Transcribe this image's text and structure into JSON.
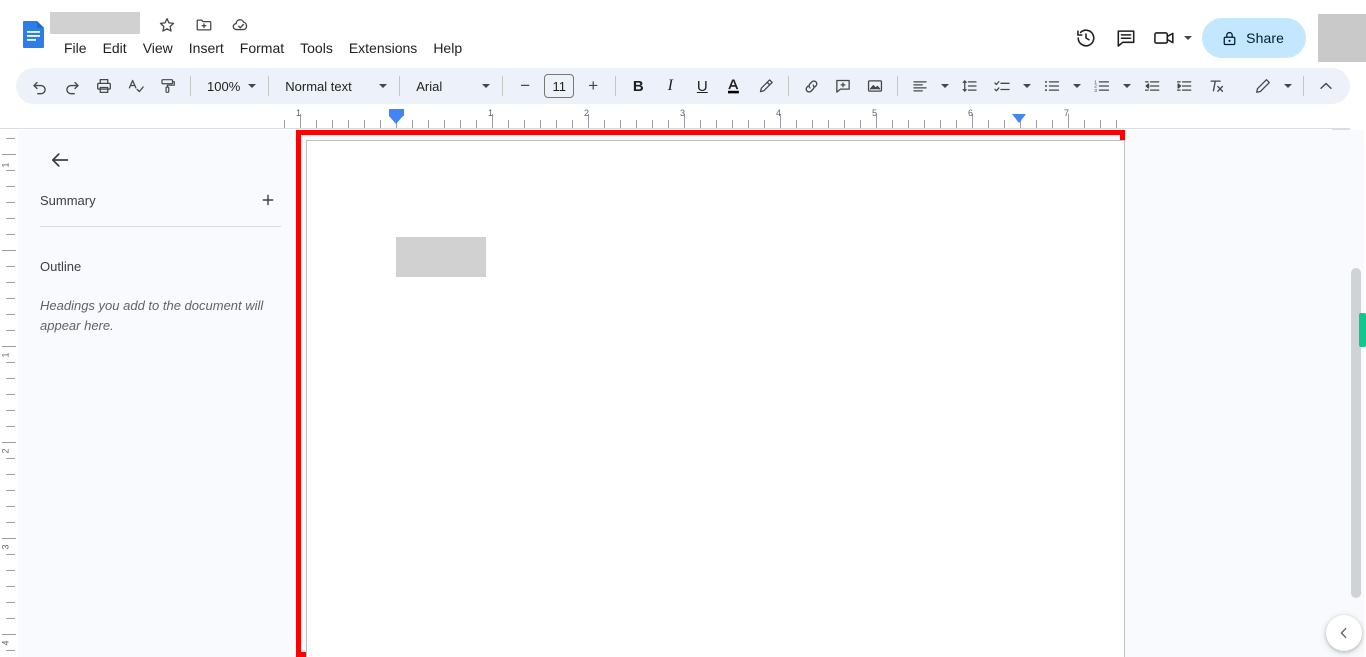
{
  "app": {
    "name": "Google Docs",
    "doc_icon": "docs-file-icon",
    "title_redacted": true
  },
  "titlebar": {
    "icons": [
      {
        "name": "star-icon",
        "label": "Star"
      },
      {
        "name": "move-to-folder-icon",
        "label": "Move"
      },
      {
        "name": "cloud-saved-icon",
        "label": "Saved to Drive"
      }
    ]
  },
  "menubar": {
    "items": [
      {
        "label": "File",
        "name": "menu-file"
      },
      {
        "label": "Edit",
        "name": "menu-edit"
      },
      {
        "label": "View",
        "name": "menu-view"
      },
      {
        "label": "Insert",
        "name": "menu-insert"
      },
      {
        "label": "Format",
        "name": "menu-format"
      },
      {
        "label": "Tools",
        "name": "menu-tools"
      },
      {
        "label": "Extensions",
        "name": "menu-extensions"
      },
      {
        "label": "Help",
        "name": "menu-help"
      }
    ]
  },
  "topbar_right": {
    "history_icon": "version-history-icon",
    "comments_icon": "comment-history-icon",
    "meet_icon": "meet-camera-icon",
    "share": {
      "label": "Share",
      "icon": "lock-icon",
      "bg_color": "#c2e7ff",
      "text_color": "#001d35"
    },
    "avatar_redacted": true
  },
  "toolbar": {
    "bg_color": "#edf2fa",
    "undo": "Undo",
    "redo": "Redo",
    "print": "Print",
    "spelling": "Spelling and grammar check",
    "paint_format": "Paint format",
    "zoom_value": "100%",
    "style_value": "Normal text",
    "font_value": "Arial",
    "font_size_value": "11",
    "decrease_font": "−",
    "increase_font": "+",
    "bold_label": "B",
    "italic_label": "I",
    "underline_label": "U",
    "text_color": "Text color",
    "highlight_color": "Highlight color",
    "insert_link": "Insert link",
    "add_comment": "Add comment",
    "insert_image": "Insert image",
    "align": "Align",
    "line_spacing": "Line & paragraph spacing",
    "checklist": "Checklist",
    "bulleted_list": "Bulleted list",
    "numbered_list": "Numbered list",
    "decrease_indent": "Decrease indent",
    "increase_indent": "Increase indent",
    "clear_formatting": "Clear formatting",
    "editing_mode": "Editing mode",
    "collapse": "Hide the menus"
  },
  "ruler": {
    "horizontal_numbers": [
      "1",
      "1",
      "2",
      "3",
      "4",
      "5",
      "6",
      "7"
    ],
    "vertical_numbers": [
      "1",
      "1",
      "2",
      "3",
      "4"
    ],
    "left_indent_marker": "left-indent-marker",
    "right_indent_marker": "right-indent-marker"
  },
  "outline_panel": {
    "back_label": "Back",
    "summary_label": "Summary",
    "add_summary_label": "+",
    "outline_label": "Outline",
    "outline_hint": "Headings you add to the document will appear here."
  },
  "document": {
    "page_highlight_color": "#ff0000",
    "page_bg": "#ffffff",
    "redacted_block": true
  },
  "right_rail": {
    "scrollbar": "vertical-scrollbar",
    "collaborator_marker_color": "#0bc98f",
    "side_panel_toggle": "show-side-panel"
  }
}
